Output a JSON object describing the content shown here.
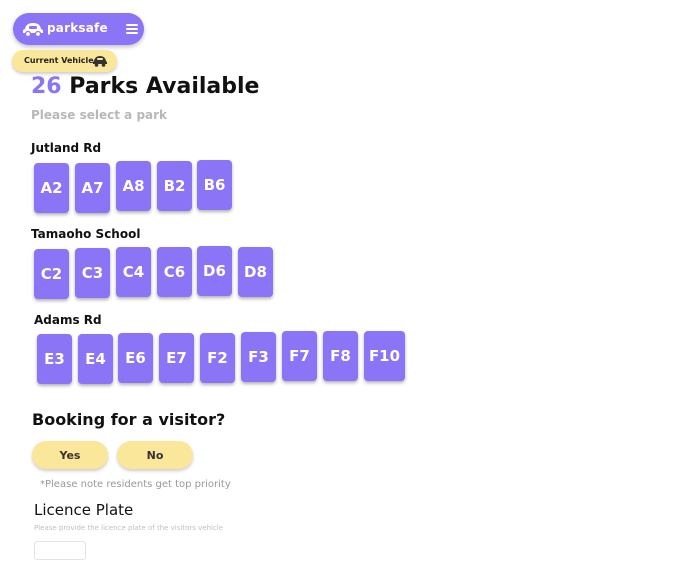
{
  "nav": {
    "brand": "parksafe",
    "menu_icon": "hamburger-menu-icon",
    "logo_icon": "car-logo-icon"
  },
  "vehicle": {
    "label": "Current Vehicle",
    "icon": "car-icon"
  },
  "header": {
    "count": "26",
    "title": "Parks Available",
    "subtitle": "Please select a park"
  },
  "streets": [
    {
      "name": "Jutland Rd",
      "parks": [
        "A2",
        "A7",
        "A8",
        "B2",
        "B6"
      ]
    },
    {
      "name": "Tamaoho School",
      "parks": [
        "C2",
        "C3",
        "C4",
        "C6",
        "D6",
        "D8"
      ]
    },
    {
      "name": "Adams Rd",
      "parks": [
        "E3",
        "E4",
        "E6",
        "E7",
        "F2",
        "F3",
        "F7",
        "F8",
        "F10"
      ]
    }
  ],
  "visitor": {
    "question": "Booking for a visitor?",
    "yes_label": "Yes",
    "no_label": "No",
    "note": "*Please note residents get top priority"
  },
  "plate": {
    "title": "Licence Plate",
    "subtitle": "Please provide the licence plate of the visitors vehicle",
    "value": ""
  },
  "colors": {
    "accent": "#8b74f5",
    "highlight": "#fbe79a"
  }
}
